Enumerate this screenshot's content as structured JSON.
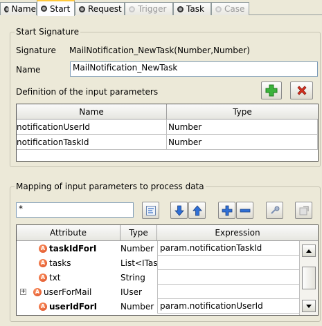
{
  "tabs": [
    {
      "label": "Name",
      "state": "normal"
    },
    {
      "label": "Start",
      "state": "active"
    },
    {
      "label": "Request",
      "state": "normal"
    },
    {
      "label": "Trigger",
      "state": "disabled"
    },
    {
      "label": "Task",
      "state": "normal"
    },
    {
      "label": "Case",
      "state": "disabled"
    }
  ],
  "start_signature": {
    "group_title": "Start Signature",
    "signature_label": "Signature",
    "signature_value": "MailNotification_NewTask(Number,Number)",
    "name_label": "Name",
    "name_value": "MailNotification_NewTask",
    "params_label": "Definition of the input parameters",
    "add_icon": "green-plus-icon",
    "remove_icon": "red-x-icon",
    "columns": {
      "name": "Name",
      "type": "Type"
    },
    "rows": [
      {
        "name": "notificationUserId",
        "type": "Number"
      },
      {
        "name": "notificationTaskId",
        "type": "Number"
      }
    ]
  },
  "mapping": {
    "group_title": "Mapping of input parameters to process data",
    "filter_value": "*",
    "columns": {
      "attribute": "Attribute",
      "type": "Type",
      "expression": "Expression"
    },
    "rows": [
      {
        "attribute": "taskIdForI",
        "type": "Number",
        "expression": "param.notificationTaskId",
        "bold": true,
        "expandable": false
      },
      {
        "attribute": "tasks",
        "type": "List<ITas",
        "expression": "",
        "bold": false,
        "expandable": false
      },
      {
        "attribute": "txt",
        "type": "String",
        "expression": "",
        "bold": false,
        "expandable": false
      },
      {
        "attribute": "userForMail",
        "type": "IUser",
        "expression": "",
        "bold": false,
        "expandable": true
      },
      {
        "attribute": "userIdForI",
        "type": "Number",
        "expression": "param.notificationUserId",
        "bold": true,
        "expandable": false
      }
    ],
    "attribute_icon_letter": "A",
    "expander_glyph": "+",
    "toolbar_icons": [
      "tree-search-icon",
      "move-down-icon",
      "move-up-icon",
      "add-icon",
      "remove-icon",
      "link-icon",
      "disabled-tool-icon"
    ]
  },
  "colors": {
    "background": "#ece9d8",
    "active_tab_accent": "#ffc83c",
    "attribute_icon": "#e0521f",
    "arrow_blue": "#2f6fd6",
    "add_green": "#2a9a2a",
    "remove_red": "#d02b1a"
  }
}
